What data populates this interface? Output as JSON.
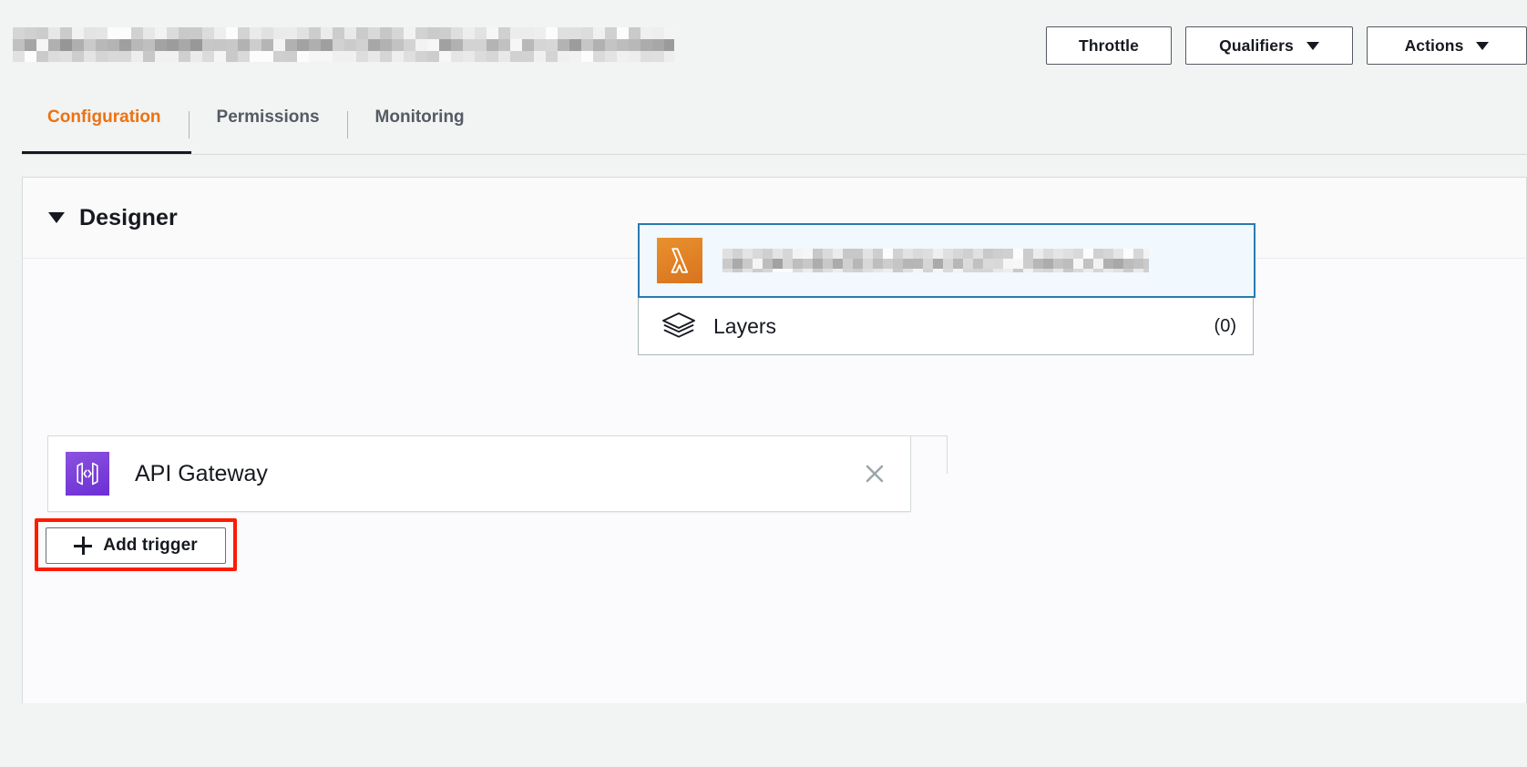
{
  "header": {
    "function_name_redacted": true,
    "buttons": [
      {
        "label": "Throttle",
        "icon": null,
        "class": "btn-throttle"
      },
      {
        "label": "Qualifiers",
        "icon": "chevron-down-icon",
        "class": "btn-qualifiers"
      },
      {
        "label": "Actions",
        "icon": "chevron-down-icon",
        "class": "btn-actions"
      }
    ]
  },
  "tabs": [
    {
      "label": "Configuration",
      "active": true
    },
    {
      "label": "Permissions",
      "active": false
    },
    {
      "label": "Monitoring",
      "active": false
    }
  ],
  "designer": {
    "title": "Designer",
    "collapse_icon": "triangle-down-icon"
  },
  "function_card": {
    "icon": "lambda-icon",
    "name_redacted": true,
    "layers": {
      "icon": "layers-stack-icon",
      "label": "Layers",
      "count": "(0)"
    }
  },
  "trigger": {
    "icon": "api-gateway-icon",
    "label": "API Gateway",
    "close_icon": "close-icon"
  },
  "add_trigger": {
    "icon": "plus-icon",
    "label": "Add trigger",
    "highlighted": true
  },
  "colors": {
    "page_background": "#f2f3f3",
    "panel_background": "#fafafa",
    "canvas_background": "#fbfafc",
    "active_tab": "#ec7211",
    "inactive_tab": "#545b64",
    "tab_underline": "#16191f",
    "lambda_orange": "#d9731f",
    "apigw_purple": "#6b2fd4",
    "selection_border": "#2a7ab0",
    "selection_fill": "#f1f8fe",
    "highlight_red": "#ff1a00",
    "border_gray": "#d5dbdb",
    "button_border": "#545b64"
  }
}
